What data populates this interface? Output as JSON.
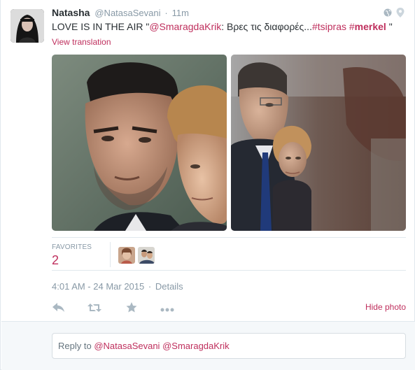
{
  "tweet": {
    "fullname": "Natasha",
    "screenname": "@NatasaSevani",
    "separator": "·",
    "time": "11m",
    "text": {
      "prefix": "LOVE IS IN THE AIR \"",
      "mention": "@SmaragdaKrik",
      "middle": ": Βρες τις διαφορές...",
      "hashtag1": "#tsipras",
      "space": " ",
      "hashtag2_hash": "#",
      "hashtag2_word": "merkel",
      "suffix": " \""
    },
    "translation_link": "View translation"
  },
  "stats": {
    "favorites_label": "FAVORITES",
    "favorites_count": "2"
  },
  "timestamp": {
    "time": "4:01 AM - 24 Mar 2015",
    "sep": "·",
    "details": "Details"
  },
  "actions": {
    "hide_photo": "Hide photo"
  },
  "reply": {
    "prefix": "Reply to ",
    "mention1": "@NatasaSevani",
    "mention2": "@SmaragdaKrik"
  },
  "icons": {
    "reply": "reply-icon",
    "retweet": "retweet-icon",
    "favorite": "star-icon",
    "more": "more-icon",
    "globe": "globe-icon",
    "location": "location-pin-icon"
  },
  "colors": {
    "accent": "#bf2f5d",
    "muted": "#8899a6",
    "text": "#292f33",
    "border": "#e1e8ed",
    "reply_bg": "#f5f8fa"
  }
}
